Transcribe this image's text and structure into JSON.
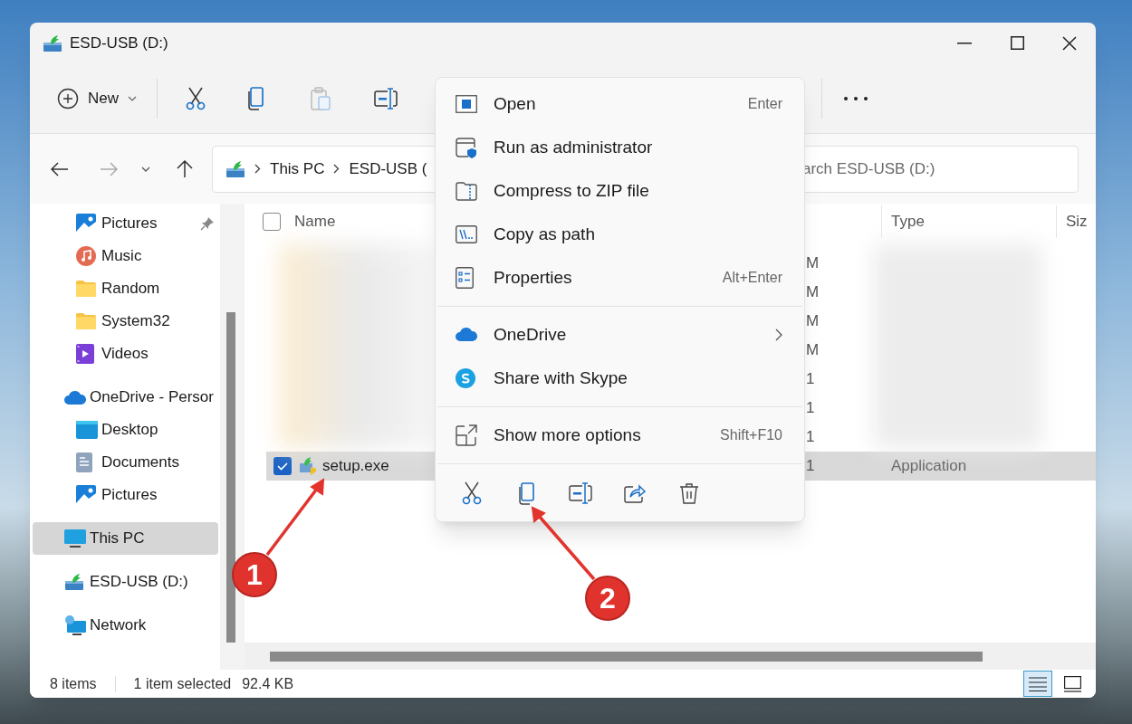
{
  "window": {
    "title": "ESD-USB (D:)"
  },
  "toolbar": {
    "new_label": "New"
  },
  "address": {
    "crumbs": [
      "This PC",
      "ESD-USB ("
    ],
    "search_placeholder": "arch ESD-USB (D:)"
  },
  "sidebar": {
    "items": [
      {
        "label": "Pictures",
        "pinned": true,
        "selected": false
      },
      {
        "label": "Music",
        "pinned": false,
        "selected": false
      },
      {
        "label": "Random",
        "pinned": false,
        "selected": false
      },
      {
        "label": "System32",
        "pinned": false,
        "selected": false
      },
      {
        "label": "Videos",
        "pinned": false,
        "selected": false
      },
      {
        "label": "OneDrive - Persor",
        "pinned": false,
        "selected": false
      },
      {
        "label": "Desktop",
        "pinned": false,
        "selected": false
      },
      {
        "label": "Documents",
        "pinned": false,
        "selected": false
      },
      {
        "label": "Pictures",
        "pinned": false,
        "selected": false
      },
      {
        "label": "This PC",
        "pinned": false,
        "selected": true
      },
      {
        "label": "ESD-USB (D:)",
        "pinned": false,
        "selected": false
      },
      {
        "label": "Network",
        "pinned": false,
        "selected": false
      }
    ]
  },
  "table": {
    "columns": [
      "Name",
      "Type",
      "Siz"
    ],
    "select_all_checked": false,
    "rows": [
      {
        "column_2": "M",
        "selected": false,
        "checked": false
      },
      {
        "column_2": "M",
        "selected": false,
        "checked": false
      },
      {
        "column_2": "M",
        "selected": false,
        "checked": false
      },
      {
        "column_2": "M",
        "selected": false,
        "checked": false
      },
      {
        "column_2": "1",
        "selected": false,
        "checked": false
      },
      {
        "column_2": "1",
        "selected": false,
        "checked": false
      },
      {
        "column_2": "1",
        "selected": false,
        "checked": false
      },
      {
        "name": "setup.exe",
        "column_2": "1",
        "type": "Application",
        "selected": true,
        "checked": true
      }
    ]
  },
  "status_bar": {
    "count": "8 items",
    "selection": "1 item selected",
    "size": "92.4 KB",
    "views": [
      {
        "kind": "details",
        "selected": true
      },
      {
        "kind": "tiles",
        "selected": false
      }
    ]
  },
  "context_menu": {
    "sections": [
      [
        {
          "label": "Open",
          "shortcut": "Enter",
          "submenu": false
        },
        {
          "label": "Run as administrator",
          "submenu": false
        },
        {
          "label": "Compress to ZIP file",
          "submenu": false
        },
        {
          "label": "Copy as path",
          "submenu": false
        },
        {
          "label": "Properties",
          "shortcut": "Alt+Enter",
          "submenu": false
        }
      ],
      [
        {
          "label": "OneDrive",
          "submenu": true
        },
        {
          "label": "Share with Skype",
          "submenu": false
        }
      ],
      [
        {
          "label": "Show more options",
          "shortcut": "Shift+F10",
          "submenu": false
        }
      ]
    ]
  },
  "annotations": [
    {
      "label": "1"
    },
    {
      "label": "2"
    }
  ]
}
